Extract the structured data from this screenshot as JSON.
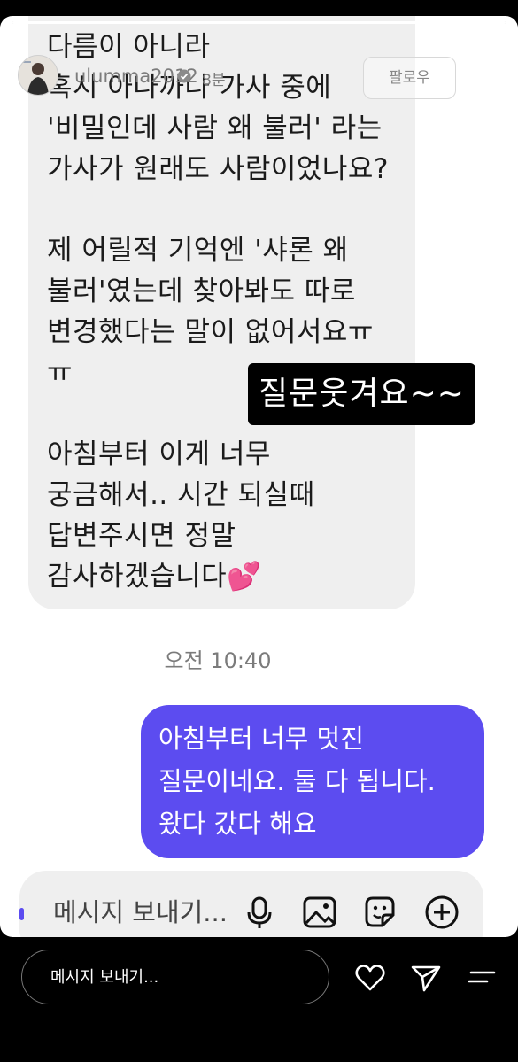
{
  "story": {
    "progress": 1.0,
    "header": {
      "username": "ulumma2012",
      "time_ago": "8분",
      "follow_label": "팔로우"
    },
    "incoming_message": "다름이 아니라\n혹시 아나까나 가사 중에\n'비밀인데 사람 왜 불러' 라는\n가사가 원래도 사람이었나요?\n\n제 어릴적 기억엔 '샤론 왜\n불러'였는데 찾아봐도 따로\n변경했다는 말이 없어서요ㅠ\nㅠ\n\n아침부터 이게 너무\n궁금해서.. 시간 되실때\n답변주시면 정말\n감사하겠습니다💕",
    "sticker_text": "질문웃겨요~~",
    "timestamp": "오전 10:40",
    "outgoing_message": "아침부터 너무 멋진\n질문이네요. 둘 다 됩니다.\n왔다 갔다 해요",
    "composer": {
      "placeholder": "메시지 보내기...",
      "icons": [
        "microphone-icon",
        "image-icon",
        "sticker-icon",
        "plus-circle-icon"
      ]
    }
  },
  "bottom_bar": {
    "reply_placeholder": "메시지 보내기...",
    "icons": [
      "heart-icon",
      "send-icon",
      "menu-icon"
    ]
  },
  "colors": {
    "outgoing_bubble": "#5c4cf0",
    "incoming_bubble": "#efefef",
    "background": "#000000"
  }
}
